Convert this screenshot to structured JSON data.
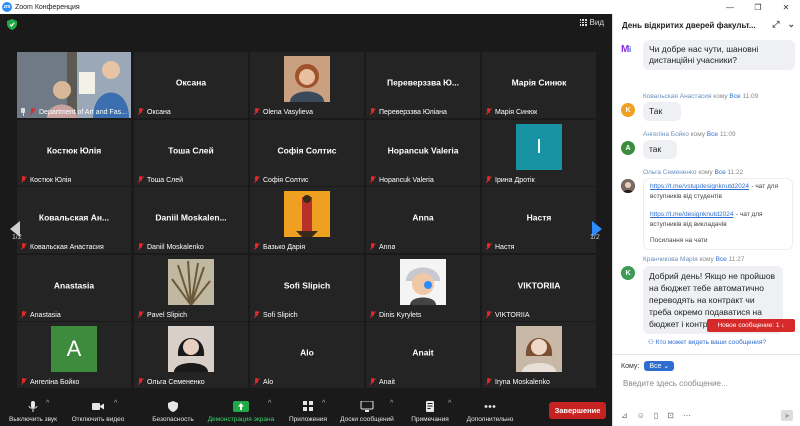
{
  "window": {
    "title": "Zoom Конференция",
    "logo": "zm"
  },
  "topbar": {
    "view_label": "Вид"
  },
  "pager": {
    "left": "1/2",
    "right": "1/2"
  },
  "tiles": [
    {
      "id": "t0",
      "center": "",
      "label": "Department of Art and Fas...",
      "pinned": true,
      "active": true,
      "kind": "video"
    },
    {
      "id": "t1",
      "center": "Оксана",
      "label": "Оксана"
    },
    {
      "id": "t2",
      "center": "",
      "label": "Olena Vasylieva",
      "kind": "photo-woman"
    },
    {
      "id": "t3",
      "center": "Переверззва Ю...",
      "label": "Переверззва Юліана"
    },
    {
      "id": "t4",
      "center": "Марія Синюк",
      "label": "Марія Синюк"
    },
    {
      "id": "t5",
      "center": "Костюк Юлія",
      "label": "Костюк Юлія"
    },
    {
      "id": "t6",
      "center": "Тоша Слей",
      "label": "Тоша Слей"
    },
    {
      "id": "t7",
      "center": "Софія Солтис",
      "label": "Софія Солтис"
    },
    {
      "id": "t8",
      "center": "Hopancuk Valeria",
      "label": "Hopancuk Valeria"
    },
    {
      "id": "t9",
      "center": "",
      "label": "Ірина Дротік",
      "letter": "I",
      "letter_color": "#1793a3"
    },
    {
      "id": "t10",
      "center": "Ковальская Ан...",
      "label": "Ковальская Анастасия"
    },
    {
      "id": "t11",
      "center": "Daniil Moskalen...",
      "label": "Daniil Moskalenko"
    },
    {
      "id": "t12",
      "center": "",
      "label": "Базько Дарія",
      "kind": "art-orange"
    },
    {
      "id": "t13",
      "center": "Anna",
      "label": "Anna"
    },
    {
      "id": "t14",
      "center": "Настя",
      "label": "Настя"
    },
    {
      "id": "t15",
      "center": "Anastasia",
      "label": "Anastasia"
    },
    {
      "id": "t16",
      "center": "",
      "label": "Pavel Slipich",
      "kind": "plant"
    },
    {
      "id": "t17",
      "center": "Sofi Slipich",
      "label": "Sofi Slipich"
    },
    {
      "id": "t18",
      "center": "",
      "label": "Dinis Kyrylets",
      "kind": "cartoon"
    },
    {
      "id": "t19",
      "center": "VIKTORIIA",
      "label": "VIKTORIIA"
    },
    {
      "id": "t20",
      "center": "",
      "label": "Ангеліна Бойко",
      "letter": "A",
      "letter_color": "#3d8b3d"
    },
    {
      "id": "t21",
      "center": "",
      "label": "Ольга Семененко",
      "kind": "photo-dark"
    },
    {
      "id": "t22",
      "center": "Alo",
      "label": "Alo"
    },
    {
      "id": "t23",
      "center": "Anait",
      "label": "Anait"
    },
    {
      "id": "t24",
      "center": "",
      "label": "Iryna Moskalenko",
      "kind": "photo-light"
    }
  ],
  "toolbar": {
    "items": [
      {
        "id": "mute",
        "label": "Выключить звук",
        "icon": "microphone-icon"
      },
      {
        "id": "video",
        "label": "Отключить видео",
        "icon": "camera-icon"
      },
      {
        "id": "security",
        "label": "Безопасность",
        "icon": "shield-icon"
      },
      {
        "id": "share",
        "label": "Демонстрация экрана",
        "icon": "share-screen-icon",
        "highlight": true
      },
      {
        "id": "apps",
        "label": "Приложения",
        "icon": "apps-icon"
      },
      {
        "id": "whiteboards",
        "label": "Доски сообщений",
        "icon": "whiteboard-icon"
      },
      {
        "id": "notes",
        "label": "Примечания",
        "icon": "notes-icon"
      },
      {
        "id": "more",
        "label": "Дополнительно",
        "icon": "more-icon"
      }
    ],
    "end_label": "Завершение",
    "colors": {
      "share": "#23a847",
      "end": "#c62222"
    }
  },
  "chat": {
    "title": "День відкритих дверей факульт...",
    "messages": [
      {
        "id": "m0",
        "avatar": "logo",
        "text": "Чи добре нас чути, шановні дистанційні учасники?"
      },
      {
        "id": "m1",
        "author": "Ковальская Анастасия",
        "to_word": "кому",
        "to": "Все",
        "time": "11:09",
        "avatar_letter": "K",
        "avatar_color": "#f0a020",
        "text": "Так"
      },
      {
        "id": "m2",
        "author": "Ангеліна Бойко",
        "to_word": "кому",
        "to": "Все",
        "time": "11:09",
        "avatar_letter": "A",
        "avatar_color": "#3d8b3d",
        "text": "так"
      },
      {
        "id": "m3",
        "author": "Ольга Семененко",
        "to_word": "кому",
        "to": "Все",
        "time": "11:22",
        "avatar": "photo",
        "link1": "https://t.me/vstupdesignknutd2024",
        "link1_sub": "- чат для вступників від студентів",
        "link2": "https://t.me/designknutd2024",
        "link2_sub": "- чат для вступників від викладачів",
        "footer": "Посилання на чати"
      },
      {
        "id": "m4",
        "author": "Кранчикова Марія",
        "to_word": "кому",
        "to": "Все",
        "time": "11:27",
        "avatar_letter": "K",
        "avatar_color": "#3d9b55",
        "text": "Добрий день! Якщо не пройшов на бюджет тебе автоматично переводять на контракт чи треба окремо подаватися на бюджет і контракт?"
      }
    ],
    "new_message": "Новое сообщение: 1 ↓",
    "who_can_see": "Кто может видеть ваши сообщения?",
    "to_label": "Кому:",
    "to_value": "Все",
    "placeholder": "Введите здесь сообщение..."
  }
}
